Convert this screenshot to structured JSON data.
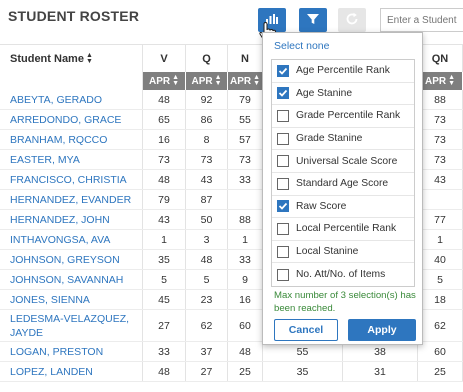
{
  "title": "STUDENT ROSTER",
  "toolbar": {
    "search_placeholder": "Enter a Student",
    "colors": {
      "primary": "#2e76bf",
      "disabled": "#e6e6e6"
    },
    "icons": [
      "bar-chart-icon",
      "filter-icon",
      "refresh-icon",
      "hand-cursor-icon"
    ]
  },
  "table": {
    "name_header": "Student Name",
    "col_headers": [
      "V",
      "Q",
      "N",
      "",
      "",
      "QN"
    ],
    "sub_headers": [
      "APR",
      "APR",
      "APR",
      "",
      "",
      "APR"
    ],
    "rows": [
      {
        "name": "ABEYTA, GERADO",
        "v": "48",
        "q": "92",
        "n": "79",
        "x1": "",
        "x2": "",
        "qn": "88"
      },
      {
        "name": "ARREDONDO, GRACE",
        "v": "65",
        "q": "86",
        "n": "55",
        "x1": "",
        "x2": "",
        "qn": "73"
      },
      {
        "name": "BRANHAM, RQCCO",
        "v": "16",
        "q": "8",
        "n": "57",
        "x1": "",
        "x2": "",
        "qn": "73"
      },
      {
        "name": "EASTER, MYA",
        "v": "73",
        "q": "73",
        "n": "73",
        "x1": "",
        "x2": "",
        "qn": "73"
      },
      {
        "name": "FRANCISCO, CHRISTIA",
        "v": "48",
        "q": "43",
        "n": "33",
        "x1": "",
        "x2": "",
        "qn": "43"
      },
      {
        "name": "HERNANDEZ, EVANDER",
        "v": "79",
        "q": "87",
        "n": "",
        "x1": "",
        "x2": "",
        "qn": ""
      },
      {
        "name": "HERNANDEZ, JOHN",
        "v": "43",
        "q": "50",
        "n": "88",
        "x1": "",
        "x2": "",
        "qn": "77"
      },
      {
        "name": "INTHAVONGSA, AVA",
        "v": "1",
        "q": "3",
        "n": "1",
        "x1": "",
        "x2": "",
        "qn": "1"
      },
      {
        "name": "JOHNSON, GREYSON",
        "v": "35",
        "q": "48",
        "n": "33",
        "x1": "",
        "x2": "",
        "qn": "40"
      },
      {
        "name": "JOHNSON, SAVANNAH",
        "v": "5",
        "q": "5",
        "n": "9",
        "x1": "",
        "x2": "",
        "qn": "5"
      },
      {
        "name": "JONES, SIENNA",
        "v": "45",
        "q": "23",
        "n": "16",
        "x1": "",
        "x2": "",
        "qn": "18"
      },
      {
        "name": "LEDESMA-VELAZQUEZ, JAYDE",
        "v": "27",
        "q": "62",
        "n": "60",
        "x1": "",
        "x2": "",
        "qn": "62"
      },
      {
        "name": "LOGAN, PRESTON",
        "v": "33",
        "q": "37",
        "n": "48",
        "x1": "55",
        "x2": "38",
        "qn": "60"
      },
      {
        "name": "LOPEZ, LANDEN",
        "v": "48",
        "q": "27",
        "n": "25",
        "x1": "35",
        "x2": "31",
        "qn": "25"
      }
    ]
  },
  "dropdown": {
    "select_none": "Select none",
    "options": [
      {
        "label": "Age Percentile Rank",
        "checked": true
      },
      {
        "label": "Age Stanine",
        "checked": true
      },
      {
        "label": "Grade Percentile Rank",
        "checked": false
      },
      {
        "label": "Grade Stanine",
        "checked": false
      },
      {
        "label": "Universal Scale Score",
        "checked": false
      },
      {
        "label": "Standard Age Score",
        "checked": false
      },
      {
        "label": "Raw Score",
        "checked": true
      },
      {
        "label": "Local Percentile Rank",
        "checked": false
      },
      {
        "label": "Local Stanine",
        "checked": false
      },
      {
        "label": "No. Att/No. of Items",
        "checked": false
      }
    ],
    "message": "Max number of 3 selection(s) has been reached.",
    "cancel_label": "Cancel",
    "apply_label": "Apply"
  }
}
